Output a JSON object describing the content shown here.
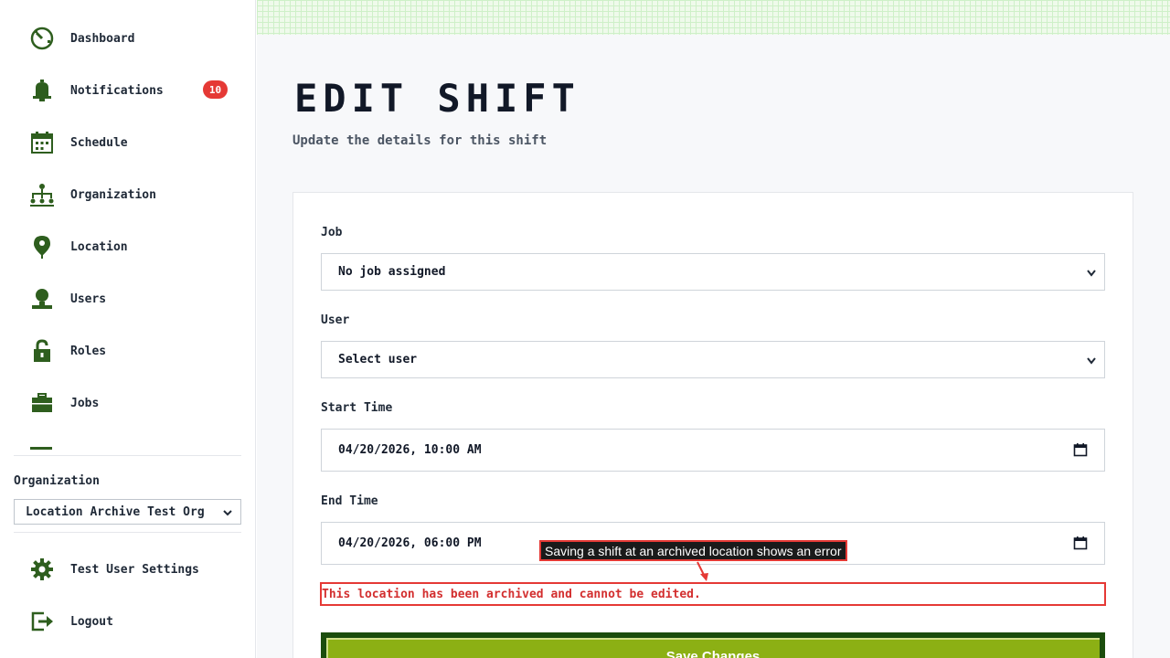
{
  "sidebar": {
    "items": [
      {
        "label": "Dashboard",
        "icon": "dashboard-icon"
      },
      {
        "label": "Notifications",
        "icon": "bell-icon",
        "badge": "10"
      },
      {
        "label": "Schedule",
        "icon": "calendar-icon"
      },
      {
        "label": "Organization",
        "icon": "org-chart-icon"
      },
      {
        "label": "Location",
        "icon": "map-pin-icon"
      },
      {
        "label": "Users",
        "icon": "user-icon"
      },
      {
        "label": "Roles",
        "icon": "lock-icon"
      },
      {
        "label": "Jobs",
        "icon": "briefcase-icon"
      }
    ],
    "org_label": "Organization",
    "org_selected": "Location Archive Test Org",
    "bottom": [
      {
        "label": "Test User Settings",
        "icon": "gear-icon"
      },
      {
        "label": "Logout",
        "icon": "logout-icon"
      }
    ]
  },
  "main": {
    "title": "EDIT SHIFT",
    "subtitle": "Update the details for this shift",
    "form": {
      "job_label": "Job",
      "job_value": "No job assigned",
      "user_label": "User",
      "user_value": "Select user",
      "start_label": "Start Time",
      "start_value": "04/20/2026, 10:00 AM",
      "end_label": "End Time",
      "end_value": "04/20/2026, 06:00 PM",
      "error": "This location has been archived and cannot be edited.",
      "save_label": "Save Changes"
    }
  },
  "annotation": "Saving a shift at an archived location shows an error",
  "colors": {
    "accent_green": "#1b4d0d",
    "button_green": "#8cb014",
    "error_red": "#e53935",
    "badge_red": "#e53935"
  }
}
